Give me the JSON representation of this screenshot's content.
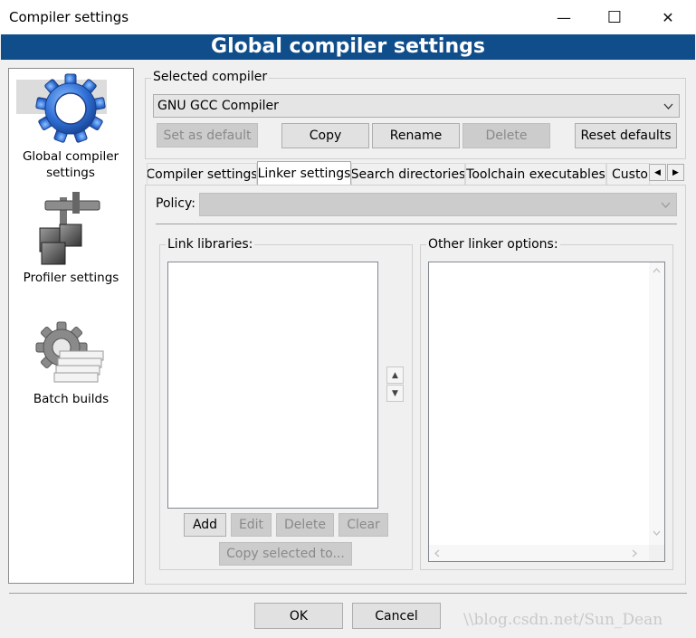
{
  "window": {
    "title": "Compiler settings",
    "banner": "Global compiler settings",
    "minimize_glyph": "—",
    "maximize_glyph": "☐",
    "close_glyph": "✕"
  },
  "sidebar": {
    "items": [
      {
        "label_line1": "Global compiler",
        "label_line2": "settings",
        "icon": "gear-icon",
        "selected": true
      },
      {
        "label": "Profiler settings",
        "icon": "profiler-icon"
      },
      {
        "label": "Batch builds",
        "icon": "batch-builds-icon"
      }
    ]
  },
  "selected_compiler": {
    "group_label": "Selected compiler",
    "value": "GNU GCC Compiler",
    "buttons": {
      "set_default": "Set as default",
      "copy": "Copy",
      "rename": "Rename",
      "delete": "Delete",
      "reset": "Reset defaults"
    }
  },
  "tabs": [
    {
      "label": "Compiler settings"
    },
    {
      "label": "Linker settings",
      "active": true
    },
    {
      "label": "Search directories"
    },
    {
      "label": "Toolchain executables"
    },
    {
      "label": "Custom"
    }
  ],
  "tab_scroll": {
    "left": "◀",
    "right": "▶"
  },
  "linker": {
    "policy_label": "Policy:",
    "policy_value": "",
    "link_libraries_label": "Link libraries:",
    "other_options_label": "Other linker options:",
    "buttons": {
      "add": "Add",
      "edit": "Edit",
      "delete": "Delete",
      "clear": "Clear",
      "copy_selected": "Copy selected to..."
    },
    "spin_up": "▲",
    "spin_down": "▼"
  },
  "footer": {
    "ok": "OK",
    "cancel": "Cancel",
    "watermark": "\\\\blog.csdn.net/Sun_Dean"
  }
}
